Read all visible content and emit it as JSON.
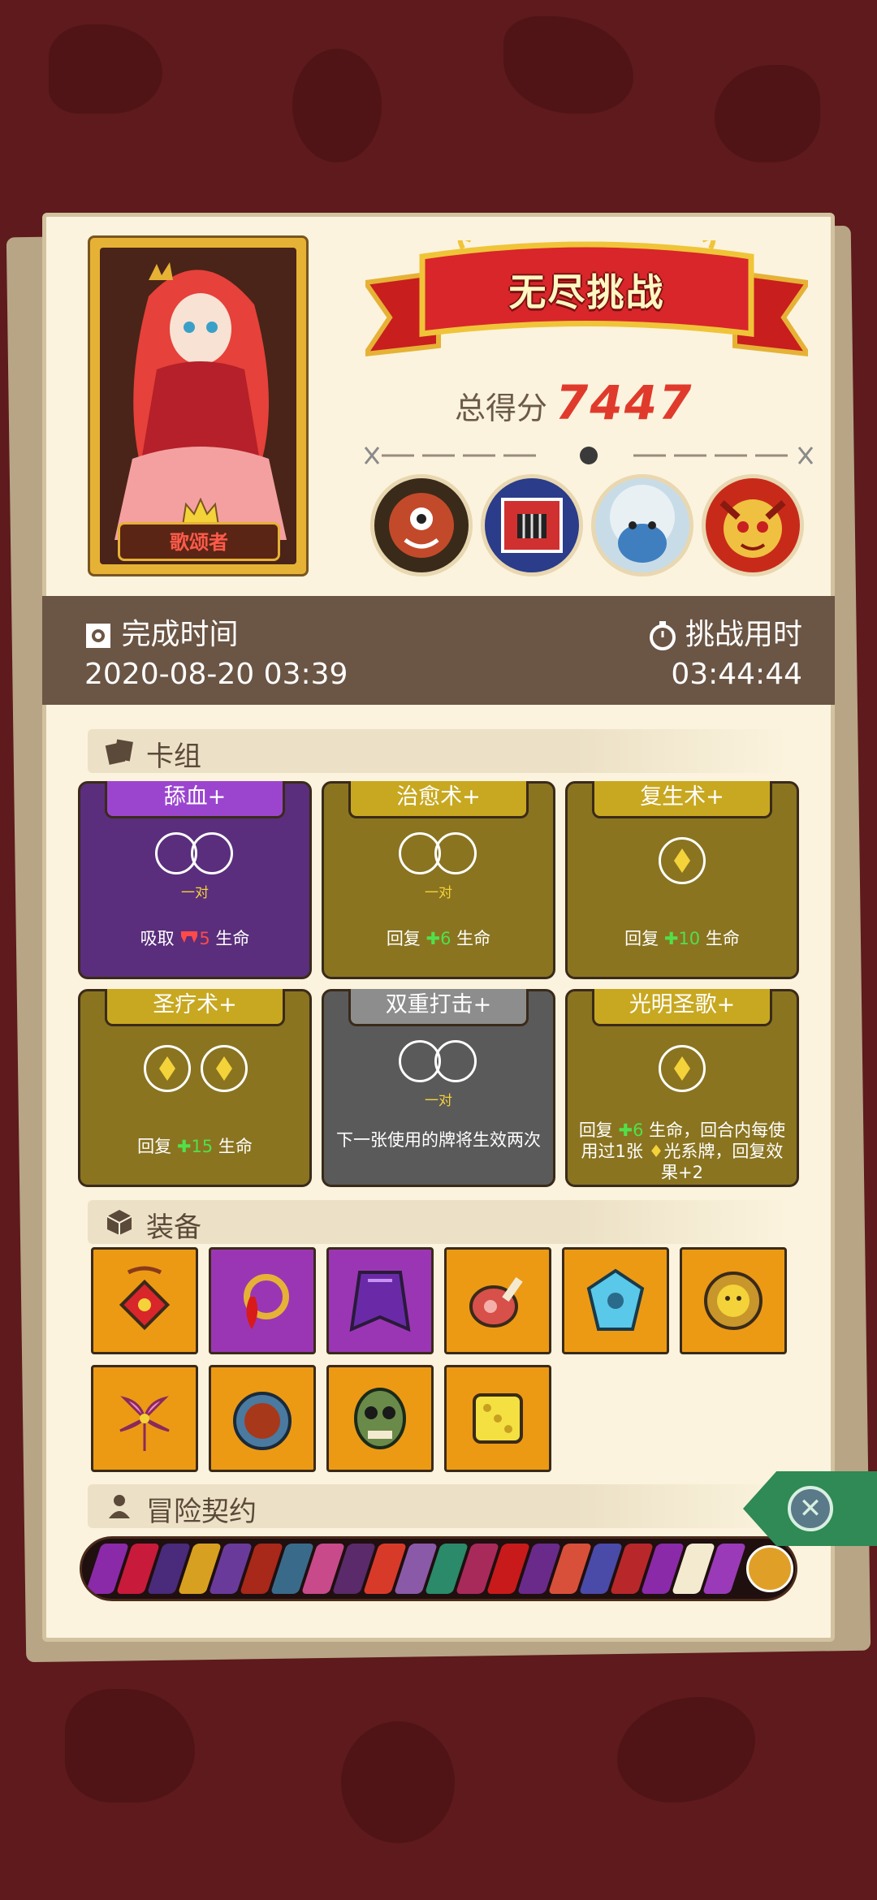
{
  "header": {
    "banner_title": "无尽挑战",
    "score_label": "总得分",
    "score_value": "7447"
  },
  "hero": {
    "name": "歌颂者",
    "icon": "crown-icon"
  },
  "bosses": [
    {
      "name": "cyclops-boss-icon",
      "color": "#c24a2a"
    },
    {
      "name": "cage-boss-icon",
      "color": "#d03030"
    },
    {
      "name": "yeti-boss-icon",
      "color": "#3f7fc0"
    },
    {
      "name": "demon-boss-icon",
      "color": "#e0452a"
    }
  ],
  "times": {
    "finish_label": "完成时间",
    "finish_value": "2020-08-20 03:39",
    "duration_label": "挑战用时",
    "duration_value": "03:44:44"
  },
  "deck": {
    "title": "卡组",
    "cards": [
      {
        "name": "舔血+",
        "sub": "一对",
        "desc_a": "吸取",
        "desc_val": "5",
        "desc_b": "生命"
      },
      {
        "name": "治愈术+",
        "sub": "一对",
        "desc_a": "回复",
        "desc_val": "6",
        "desc_b": "生命"
      },
      {
        "name": "复生术+",
        "desc_a": "回复",
        "desc_val": "10",
        "desc_b": "生命"
      },
      {
        "name": "圣疗术+",
        "desc_a": "回复",
        "desc_val": "15",
        "desc_b": "生命"
      },
      {
        "name": "双重打击+",
        "sub": "一对",
        "desc": "下一张使用的牌将生效两次"
      },
      {
        "name": "光明圣歌+",
        "desc_a": "回复",
        "desc_val": "6",
        "desc_b": "生命，回合内每使用过1张",
        "desc_c": "光系牌，回复效果+2"
      }
    ]
  },
  "equipment": {
    "title": "装备",
    "items": [
      "amulet-icon",
      "blood-ring-icon",
      "cape-icon",
      "ham-icon",
      "crystal-icon",
      "lion-ring-icon",
      "lily-icon",
      "pendant-icon",
      "skull-mask-icon",
      "dice-icon"
    ]
  },
  "contracts": {
    "title": "冒险契约"
  },
  "colors": {
    "accent_red": "#e03a2c",
    "heal_green": "#52e04a",
    "gem_yellow": "#f4d23a"
  }
}
